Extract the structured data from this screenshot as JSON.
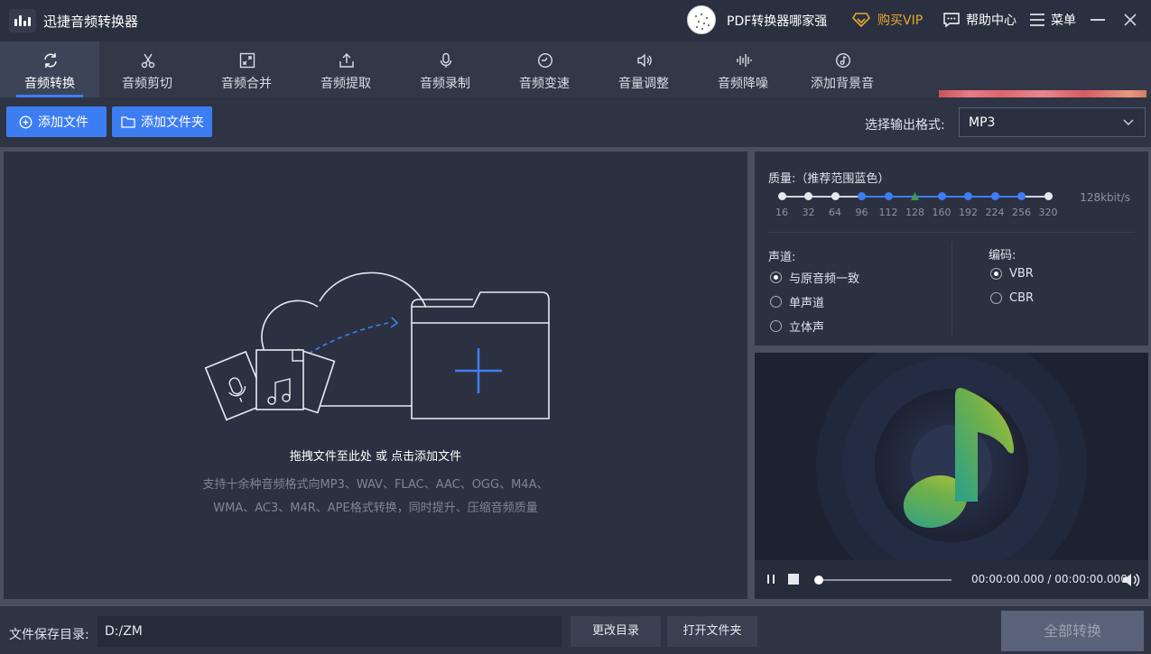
{
  "titlebar": {
    "app_title": "迅捷音频转换器",
    "user_name": "PDF转换器哪家强",
    "vip_label": "购买VIP",
    "help_label": "帮助中心",
    "menu_label": "菜单",
    "vip_color": "#e8a92c"
  },
  "tabs": [
    {
      "label": "音频转换",
      "icon": "refresh-icon",
      "active": true
    },
    {
      "label": "音频剪切",
      "icon": "scissors-icon"
    },
    {
      "label": "音频合并",
      "icon": "merge-icon"
    },
    {
      "label": "音频提取",
      "icon": "export-icon"
    },
    {
      "label": "音频录制",
      "icon": "microphone-icon"
    },
    {
      "label": "音频变速",
      "icon": "speed-icon"
    },
    {
      "label": "音量调整",
      "icon": "speaker-icon"
    },
    {
      "label": "音频降噪",
      "icon": "waveform-icon"
    },
    {
      "label": "添加背景音",
      "icon": "music-note-icon"
    }
  ],
  "toolbar": {
    "add_file": "添加文件",
    "add_folder": "添加文件夹",
    "format_label": "选择输出格式:",
    "format_value": "MP3",
    "accent": "#3d7df2"
  },
  "dropzone": {
    "title": "拖拽文件至此处 或 点击添加文件",
    "desc_line1": "支持十余种音频格式向MP3、WAV、FLAC、AAC、OGG、M4A、",
    "desc_line2": "WMA、AC3、M4R、APE格式转换，同时提升、压缩音频质量"
  },
  "settings": {
    "quality_label": "质量:（推荐范围蓝色）",
    "quality_value": "128kbit/s",
    "bitrates": [
      "16",
      "32",
      "64",
      "96",
      "112",
      "128",
      "160",
      "192",
      "224",
      "256",
      "320"
    ],
    "selected_bitrate": "128",
    "channel_label": "声道:",
    "channels": [
      "与原音频一致",
      "单声道",
      "立体声"
    ],
    "selected_channel": 0,
    "encoding_label": "编码:",
    "encodings": [
      "VBR",
      "CBR"
    ],
    "selected_encoding": 0
  },
  "player": {
    "time": "00:00:00.000 / 00:00:00.000",
    "progress": 0
  },
  "footer": {
    "save_label": "文件保存目录:",
    "save_path": "D:/ZM",
    "change_dir": "更改目录",
    "open_folder": "打开文件夹",
    "convert_all": "全部转换"
  }
}
